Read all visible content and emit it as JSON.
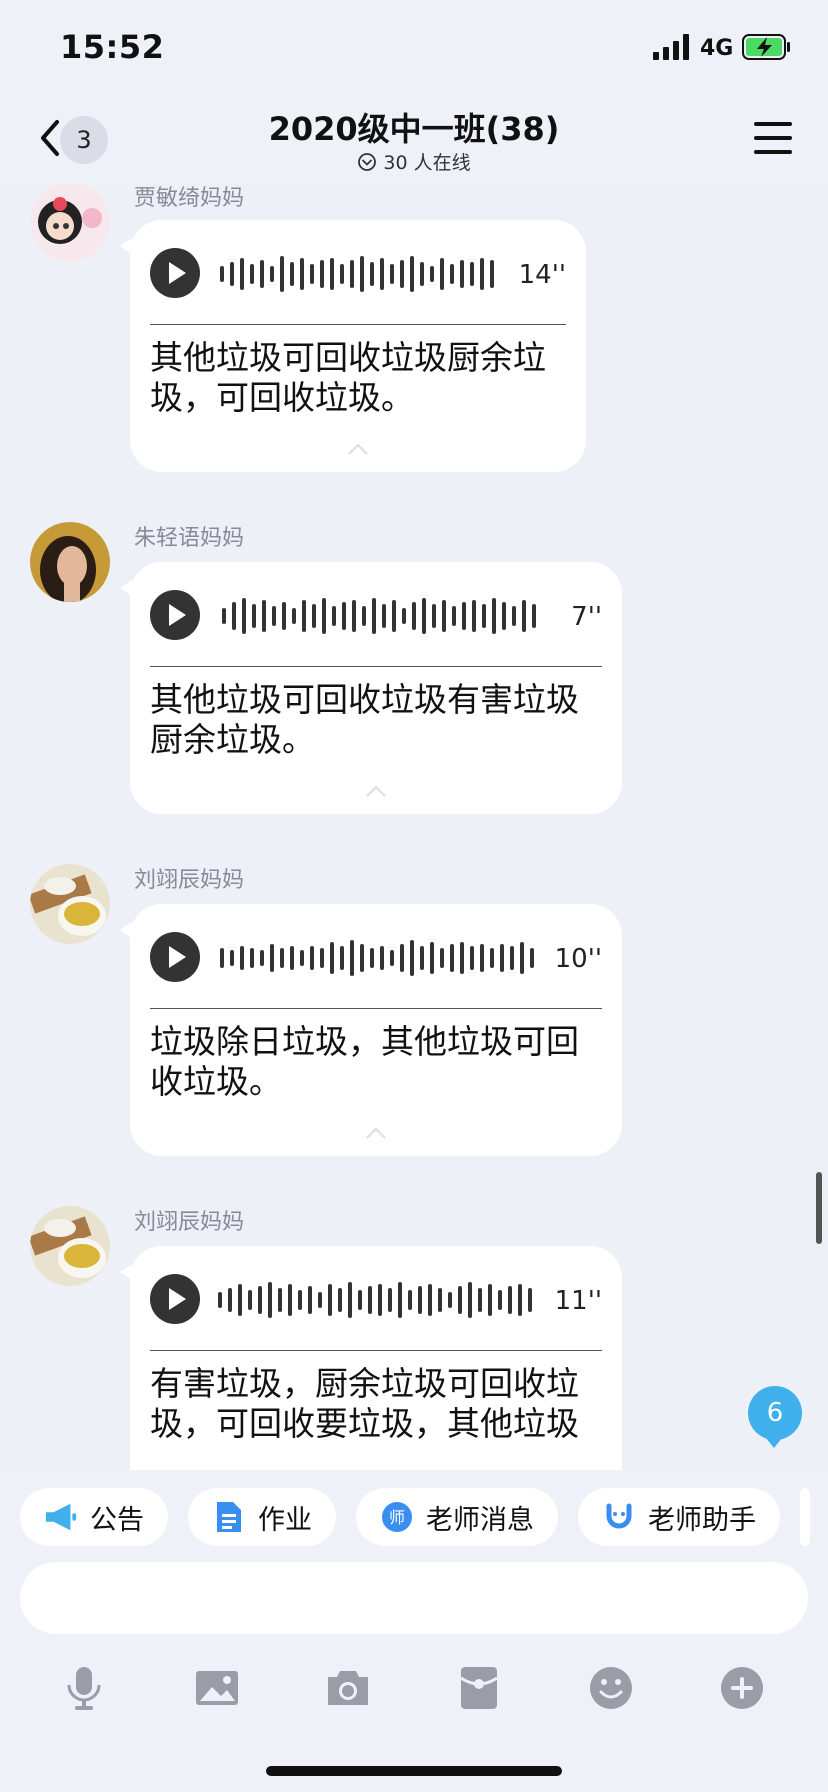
{
  "status_bar": {
    "time": "15:52",
    "network": "4G"
  },
  "header": {
    "back_count": "3",
    "title": "2020级中一班(38)",
    "online_text": "30 人在线"
  },
  "messages": [
    {
      "sender": "贾敏绮妈妈",
      "duration": "14''",
      "transcript": "其他垃圾可回收垃圾厨余垃圾，可回收垃圾。"
    },
    {
      "sender": "朱轻语妈妈",
      "duration": "7''",
      "transcript": "其他垃圾可回收垃圾有害垃圾厨余垃圾。"
    },
    {
      "sender": "刘翊辰妈妈",
      "duration": "10''",
      "transcript": "垃圾除日垃圾，其他垃圾可回收垃圾。"
    },
    {
      "sender": "刘翊辰妈妈",
      "duration": "11''",
      "transcript": "有害垃圾，厨余垃圾可回收垃圾，可回收要垃圾，其他垃圾"
    }
  ],
  "new_message_count": "6",
  "quick_actions": [
    {
      "label": "公告",
      "icon": "megaphone-icon"
    },
    {
      "label": "作业",
      "icon": "document-icon"
    },
    {
      "label": "老师消息",
      "icon": "teacher-message-icon"
    },
    {
      "label": "老师助手",
      "icon": "teacher-assistant-icon"
    }
  ],
  "input": {
    "value": "",
    "placeholder": ""
  },
  "toolbar": [
    {
      "icon": "microphone-icon"
    },
    {
      "icon": "image-icon"
    },
    {
      "icon": "camera-icon"
    },
    {
      "icon": "red-packet-icon"
    },
    {
      "icon": "emoji-icon"
    },
    {
      "icon": "plus-icon"
    }
  ],
  "colors": {
    "background": "#eef0f8",
    "bubble": "#ffffff",
    "badge": "#3fb0ec",
    "accent_blue": "#3a8ef0"
  }
}
